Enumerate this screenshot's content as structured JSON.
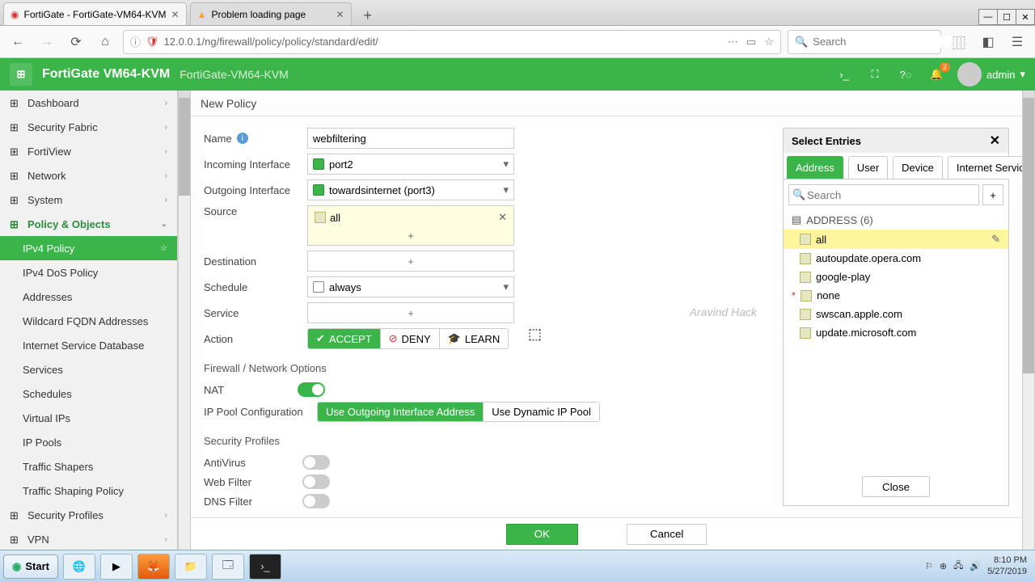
{
  "browser": {
    "tabs": [
      {
        "title": "FortiGate - FortiGate-VM64-KVM",
        "active": true
      },
      {
        "title": "Problem loading page",
        "active": false
      }
    ],
    "url": "12.0.0.1/ng/firewall/policy/policy/standard/edit/",
    "search_placeholder": "Search"
  },
  "header": {
    "product": "FortiGate VM64-KVM",
    "hostname": "FortiGate-VM64-KVM",
    "user": "admin",
    "bell_badge": "2"
  },
  "sidebar": {
    "items": [
      {
        "label": "Dashboard",
        "chev": true
      },
      {
        "label": "Security Fabric",
        "chev": true
      },
      {
        "label": "FortiView",
        "chev": true
      },
      {
        "label": "Network",
        "chev": true
      },
      {
        "label": "System",
        "chev": true
      },
      {
        "label": "Policy & Objects",
        "chev": true,
        "active_parent": true
      },
      {
        "label": "IPv4 Policy",
        "child": true,
        "selected": true,
        "star": true
      },
      {
        "label": "IPv4 DoS Policy",
        "child": true
      },
      {
        "label": "Addresses",
        "child": true
      },
      {
        "label": "Wildcard FQDN Addresses",
        "child": true
      },
      {
        "label": "Internet Service Database",
        "child": true
      },
      {
        "label": "Services",
        "child": true
      },
      {
        "label": "Schedules",
        "child": true
      },
      {
        "label": "Virtual IPs",
        "child": true
      },
      {
        "label": "IP Pools",
        "child": true
      },
      {
        "label": "Traffic Shapers",
        "child": true
      },
      {
        "label": "Traffic Shaping Policy",
        "child": true
      },
      {
        "label": "Security Profiles",
        "chev": true
      },
      {
        "label": "VPN",
        "chev": true
      }
    ]
  },
  "crumb": "New Policy",
  "form": {
    "name_label": "Name",
    "name_value": "webfiltering",
    "incoming_label": "Incoming Interface",
    "incoming_value": "port2",
    "outgoing_label": "Outgoing Interface",
    "outgoing_value": "towardsinternet (port3)",
    "source_label": "Source",
    "source_chip": "all",
    "destination_label": "Destination",
    "schedule_label": "Schedule",
    "schedule_value": "always",
    "service_label": "Service",
    "action_label": "Action",
    "action_accept": "ACCEPT",
    "action_deny": "DENY",
    "action_learn": "LEARN",
    "fw_section": "Firewall / Network Options",
    "nat_label": "NAT",
    "ippool_label": "IP Pool Configuration",
    "ippool_out": "Use Outgoing Interface Address",
    "ippool_dyn": "Use Dynamic IP Pool",
    "sec_section": "Security Profiles",
    "av_label": "AntiVirus",
    "wf_label": "Web Filter",
    "df_label": "DNS Filter"
  },
  "panel": {
    "title": "Select Entries",
    "tabs": [
      "Address",
      "User",
      "Device",
      "Internet Service"
    ],
    "search_placeholder": "Search",
    "group": "ADDRESS (6)",
    "entries": [
      {
        "label": "all",
        "selected": true
      },
      {
        "label": "autoupdate.opera.com"
      },
      {
        "label": "google-play"
      },
      {
        "label": "none",
        "star": true
      },
      {
        "label": "swscan.apple.com"
      },
      {
        "label": "update.microsoft.com"
      }
    ],
    "close": "Close"
  },
  "footer": {
    "ok": "OK",
    "cancel": "Cancel"
  },
  "taskbar": {
    "start": "Start",
    "time": "8:10 PM",
    "date": "5/27/2019"
  },
  "watermark": "Aravind Hack"
}
